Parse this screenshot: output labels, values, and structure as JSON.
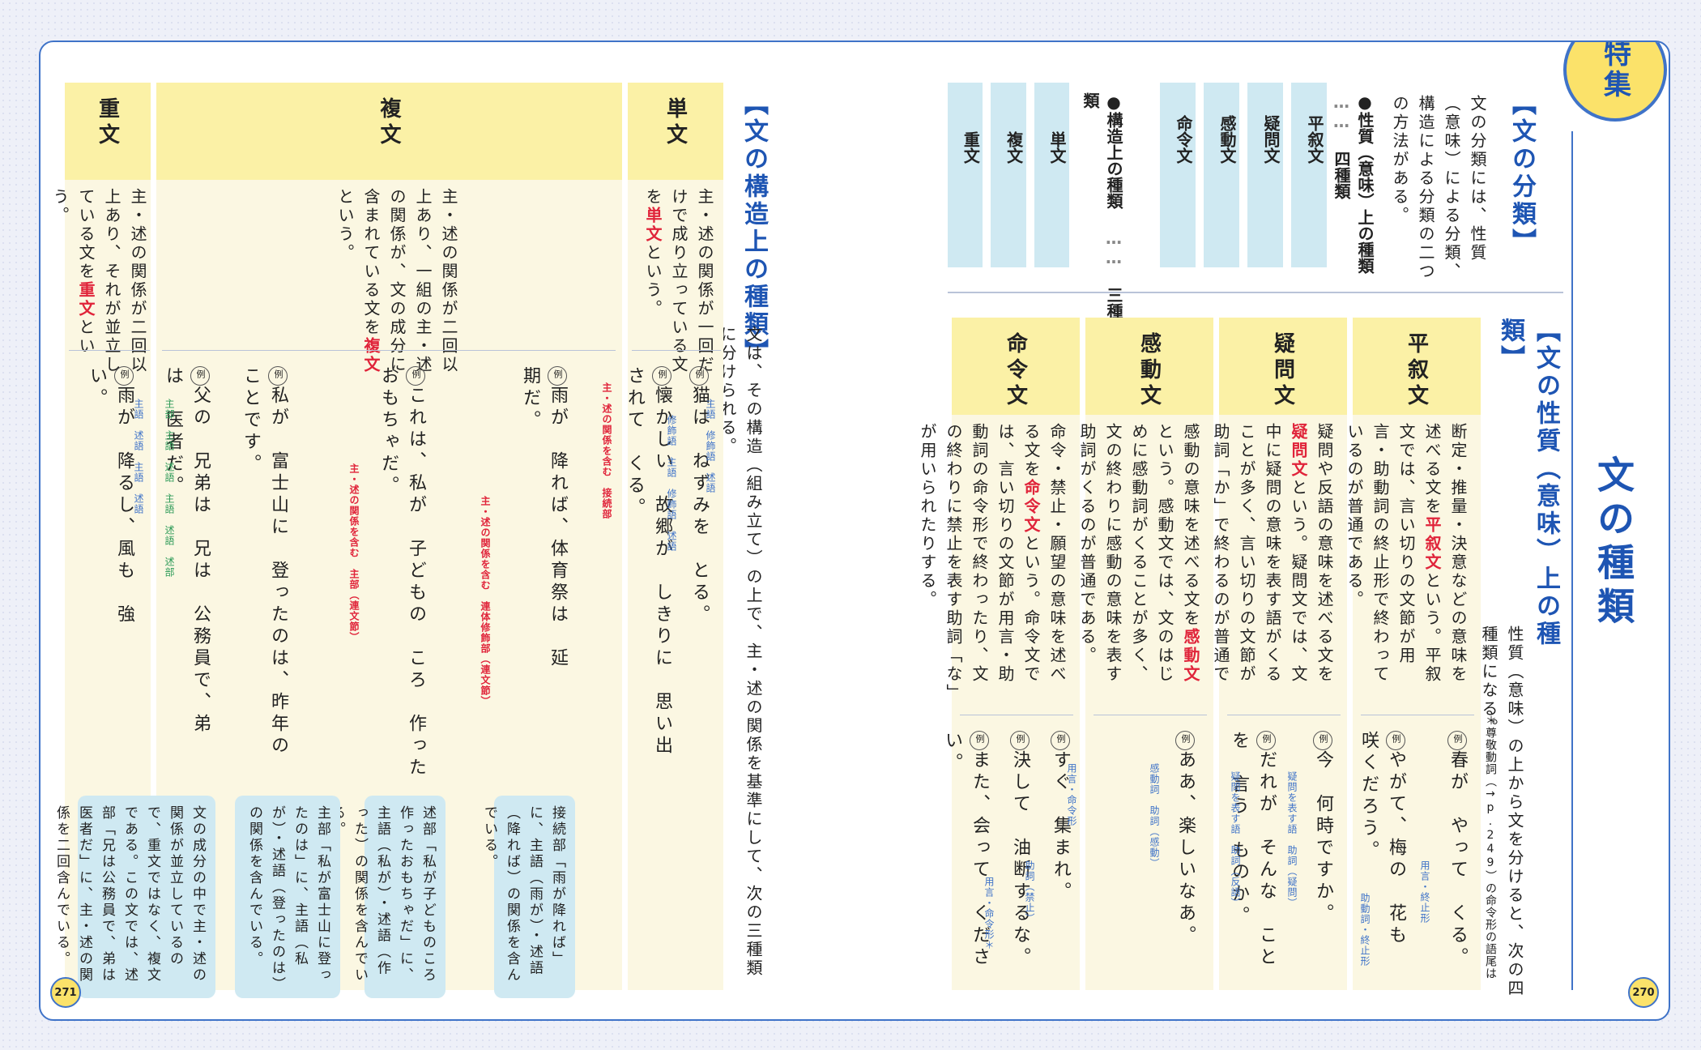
{
  "page_numbers": {
    "left": "271",
    "right": "270"
  },
  "feature_badge": "特集",
  "main_title": "文の種類",
  "classification": {
    "heading": "【文の分類】",
    "body": "文の分類には、性質（意味）による分類、構造による分類の二つの方法がある。",
    "nature_label": "●性質（意味）上の種類",
    "nature_count": "四種類",
    "structure_label": "●構造上の種類",
    "structure_count": "三種類",
    "nature_cells": [
      "平叙文",
      "疑問文",
      "感動文",
      "命令文"
    ],
    "structure_cells": [
      "単文",
      "複文",
      "重文"
    ]
  },
  "nature_section": {
    "heading": "【文の性質（意味）上の種類】",
    "intro": "性質（意味）の上から文を分けると、次の四種類になる。",
    "footnote": "＊尊敬動詞（→p.249）の命令形の語尾は「い」になる。",
    "columns": [
      {
        "title": "平叙文",
        "desc_pre": "断定・推量・決意などの意味を述べる文を",
        "desc_key": "平叙文",
        "desc_post": "という。平叙文では、言い切りの文節が用言・助動詞の終止形で終わっているのが普通である。",
        "examples": [
          "春が　やって　くる。",
          "やがて、梅の　花も　咲くだろう。"
        ],
        "notes": [
          "用言・終止形",
          "助動詞・終止形"
        ]
      },
      {
        "title": "疑問文",
        "desc_pre": "疑問や反語の意味を述べる文を",
        "desc_key": "疑問文",
        "desc_post": "という。疑問文では、文中に疑問の意味を表す語がくることが多く、言い切りの文節が助詞「か」で終わるのが普通である。",
        "examples": [
          "今　何時ですか。",
          "だれが　そんな　ことを　言う　ものか。"
        ],
        "notes": [
          "疑問を表す語　助詞（疑問）",
          "疑問を表す語　助詞（反語）"
        ]
      },
      {
        "title": "感動文",
        "desc_pre": "感動の意味を述べる文を",
        "desc_key": "感動文",
        "desc_post": "という。感動文では、文のはじめに感動詞がくることが多く、文の終わりに感動の意味を表す助詞がくるのが普通である。",
        "examples": [
          "ああ、楽しいなあ。"
        ],
        "notes": [
          "感動詞　助詞（感動）"
        ]
      },
      {
        "title": "命令文",
        "desc_pre": "命令・禁止・願望の意味を述べる文を",
        "desc_key": "命令文",
        "desc_post": "という。命令文では、言い切りの文節が用言・助動詞の命令形で終わったり、文の終わりに禁止を表す助詞「な」が用いられたりする。",
        "examples": [
          "すぐ　集まれ。",
          "決して　油断するな。",
          "また、会って　ください。"
        ],
        "notes": [
          "用言・命令形",
          "助詞（禁止）",
          "用言・命令形＊"
        ]
      }
    ]
  },
  "structure_section": {
    "heading": "【文の構造上の種類】",
    "intro": "文は、その構造（組み立て）の上で、主・述の関係を基準にして、次の三種類に分けられる。",
    "columns": [
      {
        "title": "単文",
        "desc_pre": "主・述の関係が一回だけで成り立っている文を",
        "desc_key": "単文",
        "desc_post": "という。",
        "examples": [
          "猫は　ねずみを　とる。",
          "懐かしい　故郷が　しきりに　思い出されて　くる。"
        ],
        "notes": [
          "主語　修飾語　述語",
          "修飾語　主語　修飾語　述語"
        ]
      },
      {
        "title": "複文",
        "desc_pre": "主・述の関係が二回以上あり、一組の主・述の関係が、文の成分に含まれている文を",
        "desc_key": "複文",
        "desc_post": "という。",
        "examples": [
          "雨が　降れば、体育祭は　延期だ。",
          "これは、私が　子どもの　ころ　作った　おもちゃだ。",
          "私が　富士山に　登ったのは、昨年の　ことです。"
        ],
        "notes": [
          "主・述の関係を含む　接続部",
          "主・述の関係を含む　連体修飾部（連文節）",
          "主・述の関係を含む　主部（連文節）"
        ],
        "callouts": [
          "接続部「雨が降れば」に、主語（雨が）・述語（降れば）の関係を含んでいる。",
          "述部「私が子どものころ作ったおもちゃだ」に、主語（私が）・述語（作った）の関係を含んでいる。",
          "主部「私が富士山に登ったのは」に、主語（私が）・述語（登ったのは）の関係を含んでいる。"
        ]
      },
      {
        "title": "重文",
        "desc_pre": "主・述の関係が二回以上あり、それが並立している文を",
        "desc_key": "重文",
        "desc_post": "という。",
        "examples": [
          "雨が　降るし、風も　強い。",
          "父の　兄弟は　兄は　公務員で、弟は　医者だ。"
        ],
        "notes": [
          "主語　述語　主語　述語",
          "主部　主語　述語　主語　述語　述部"
        ],
        "callouts": [
          "文の成分の中で主・述の関係が並立しているので、重文ではなく、複文である。この文では、述部「兄は公務員で、弟は医者だ」に、主・述の関係を二回含んでいる。"
        ]
      }
    ]
  }
}
